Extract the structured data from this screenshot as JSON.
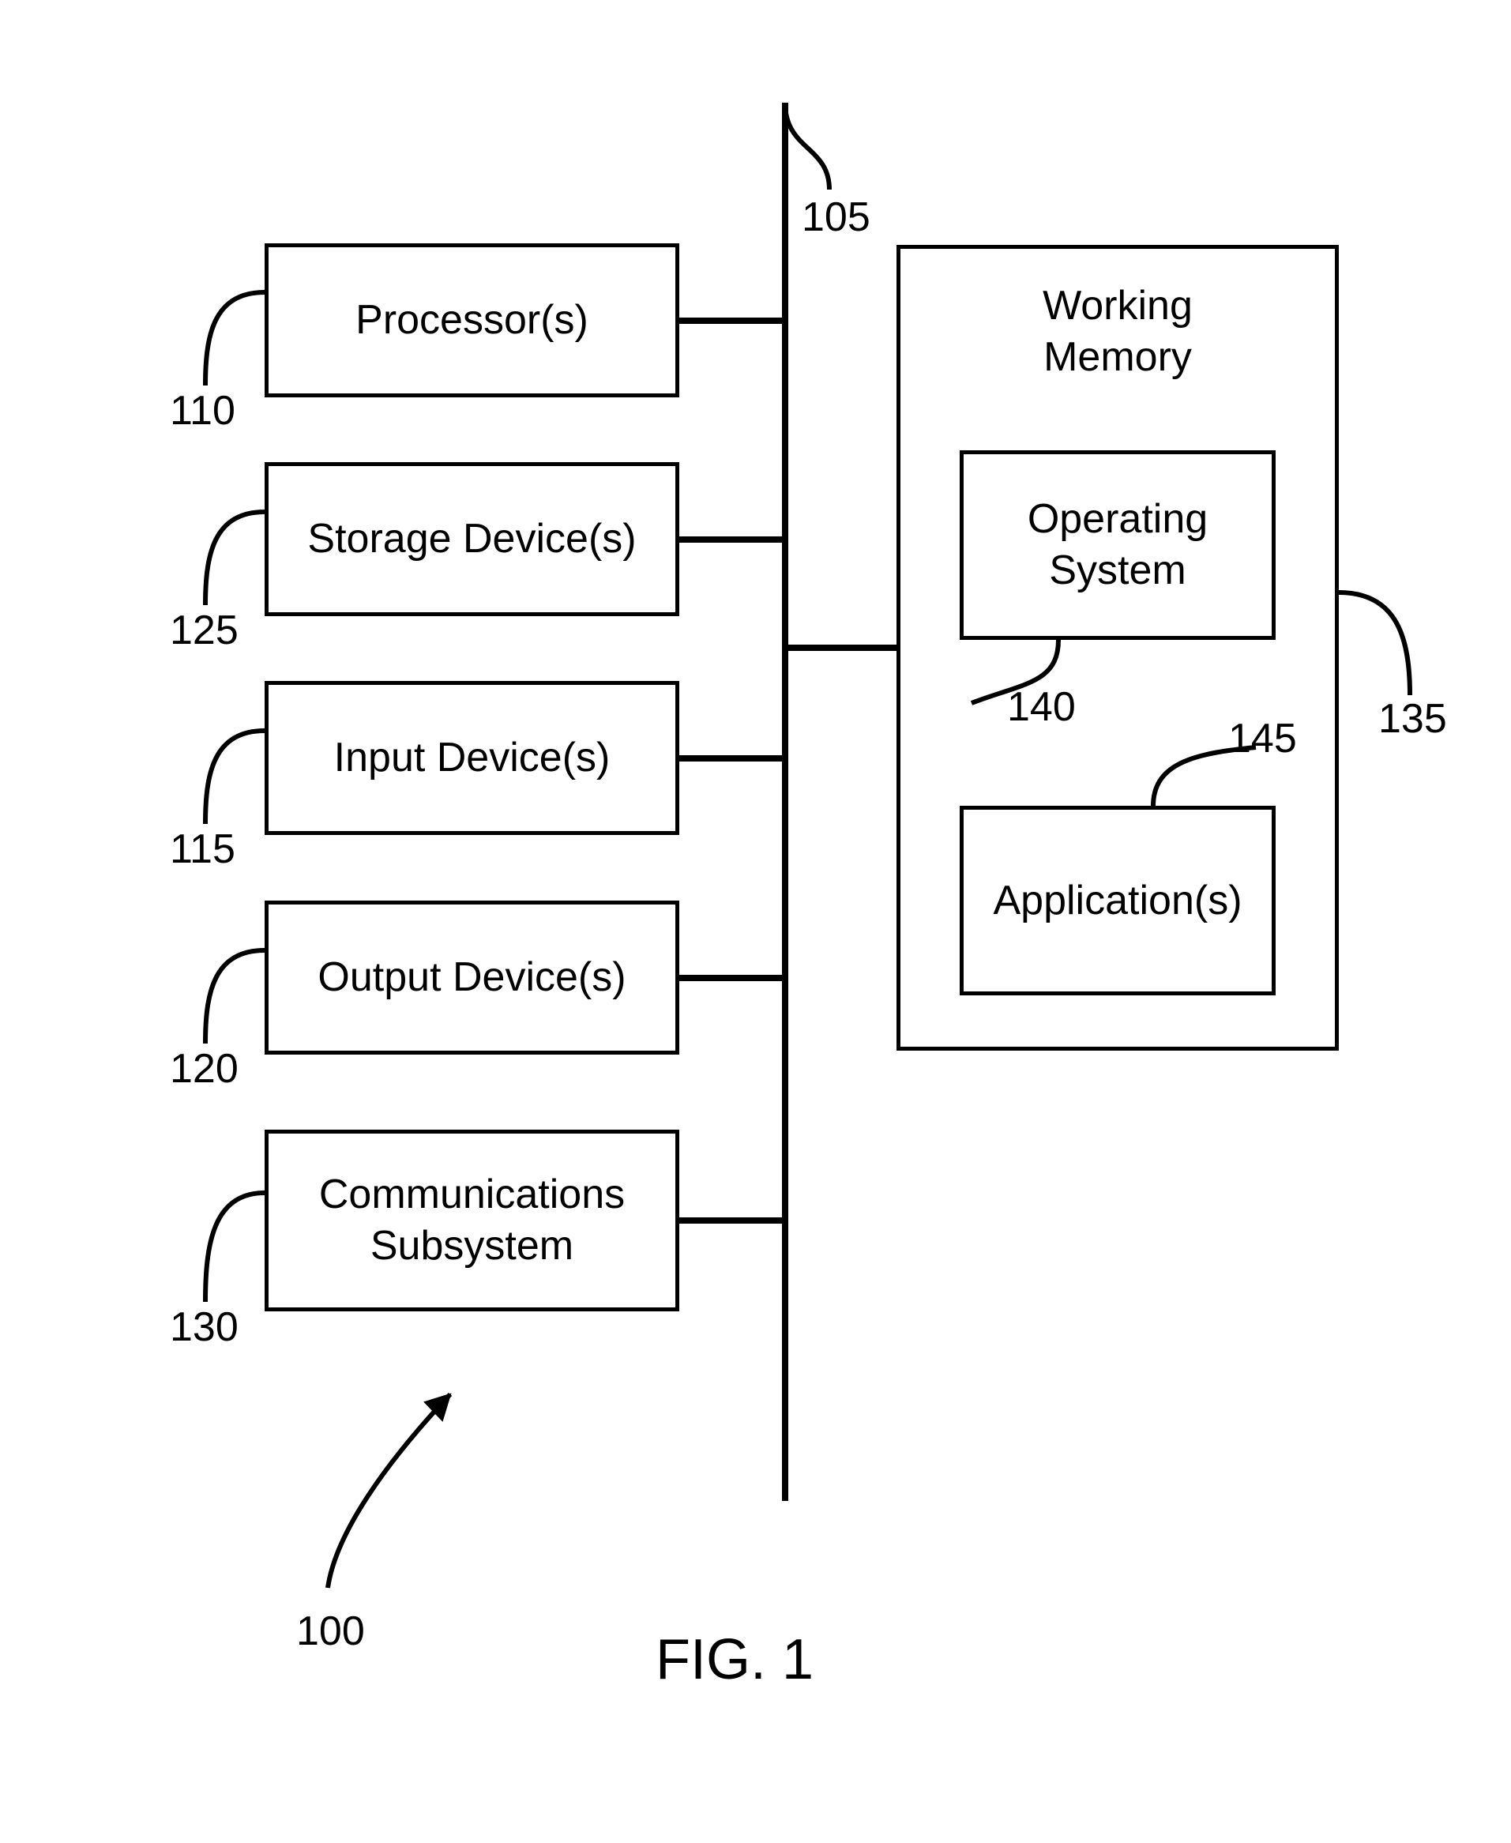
{
  "figure_label": "FIG. 1",
  "refs": {
    "system": "100",
    "bus": "105",
    "processor": "110",
    "input": "115",
    "output": "120",
    "storage": "125",
    "comms": "130",
    "working_memory": "135",
    "os": "140",
    "apps": "145"
  },
  "boxes": {
    "processor": "Processor(s)",
    "storage": "Storage Device(s)",
    "input": "Input Device(s)",
    "output": "Output Device(s)",
    "comms": "Communications\nSubsystem",
    "working_memory": "Working\nMemory",
    "os": "Operating\nSystem",
    "apps": "Application(s)"
  }
}
